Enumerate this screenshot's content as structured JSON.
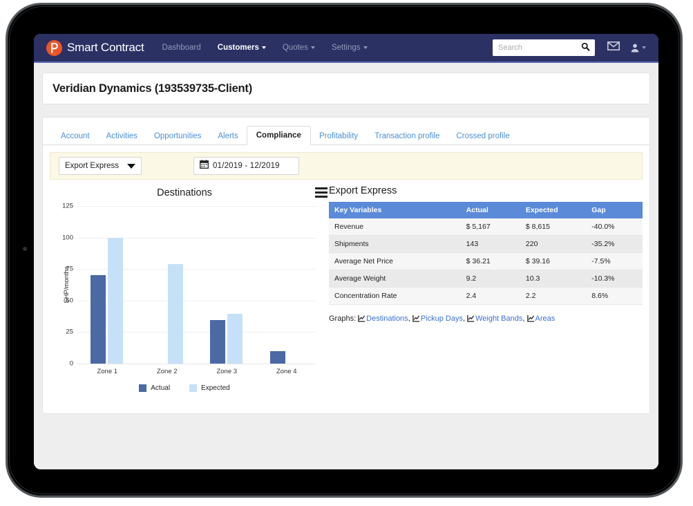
{
  "navbar": {
    "logo_icon": "p-logo-icon",
    "brand": "Smart Contract",
    "links": [
      {
        "label": "Dashboard",
        "active": false,
        "caret": false
      },
      {
        "label": "Customers",
        "active": true,
        "caret": true
      },
      {
        "label": "Quotes",
        "active": false,
        "caret": true
      },
      {
        "label": "Settings",
        "active": false,
        "caret": true
      }
    ],
    "search": {
      "placeholder": "Search",
      "value": "",
      "icon": "search-icon"
    },
    "mail_icon": "envelope-icon",
    "user_icon": "user-icon",
    "bg_color": "#2b3163"
  },
  "page": {
    "title": "Veridian Dynamics (193539735-Client)"
  },
  "tabs": [
    {
      "label": "Account",
      "active": false
    },
    {
      "label": "Activities",
      "active": false
    },
    {
      "label": "Opportunities",
      "active": false
    },
    {
      "label": "Alerts",
      "active": false
    },
    {
      "label": "Compliance",
      "active": true
    },
    {
      "label": "Profitability",
      "active": false
    },
    {
      "label": "Transaction profile",
      "active": false
    },
    {
      "label": "Crossed profile",
      "active": false
    }
  ],
  "filter_bar": {
    "product_select": {
      "value": "Export Express",
      "icon": "chevron-down-icon"
    },
    "date_range": {
      "value": "01/2019  -  12/2019",
      "icon": "calendar-icon"
    }
  },
  "chart_data": {
    "type": "bar",
    "title": "Destinations",
    "xlabel": "",
    "ylabel": "SHP/months",
    "categories": [
      "Zone 1",
      "Zone 2",
      "Zone 3",
      "Zone 4"
    ],
    "series": [
      {
        "name": "Actual",
        "color": "#4a69a5",
        "values": [
          70,
          0,
          34.5,
          10
        ]
      },
      {
        "name": "Expected",
        "color": "#c6e0f7",
        "values": [
          100,
          79,
          39.5,
          0
        ]
      }
    ],
    "ylim": [
      0,
      125
    ],
    "yticks": [
      0,
      25,
      50,
      75,
      100,
      125
    ],
    "grid": true,
    "legend_position": "bottom",
    "menu_icon": "hamburger-menu-icon"
  },
  "info_panel": {
    "title": "Export Express",
    "table": {
      "columns": [
        "Key Variables",
        "Actual",
        "Expected",
        "Gap"
      ],
      "rows": [
        [
          "Revenue",
          "$ 5,167",
          "$ 8,615",
          "-40.0%"
        ],
        [
          "Shipments",
          "143",
          "220",
          "-35.2%"
        ],
        [
          "Average Net Price",
          "$ 36.21",
          "$ 39.16",
          "-7.5%"
        ],
        [
          "Average Weight",
          "9.2",
          "10.3",
          "-10.3%"
        ],
        [
          "Concentration Rate",
          "2.4",
          "2.2",
          "8.6%"
        ]
      ],
      "header_color": "#5a8ad8"
    },
    "graphs": {
      "label": "Graphs:",
      "links": [
        "Destinations",
        "Pickup Days",
        "Weight Bands",
        "Areas"
      ],
      "link_icon": "line-chart-icon",
      "link_color": "#3d6fd0"
    }
  }
}
